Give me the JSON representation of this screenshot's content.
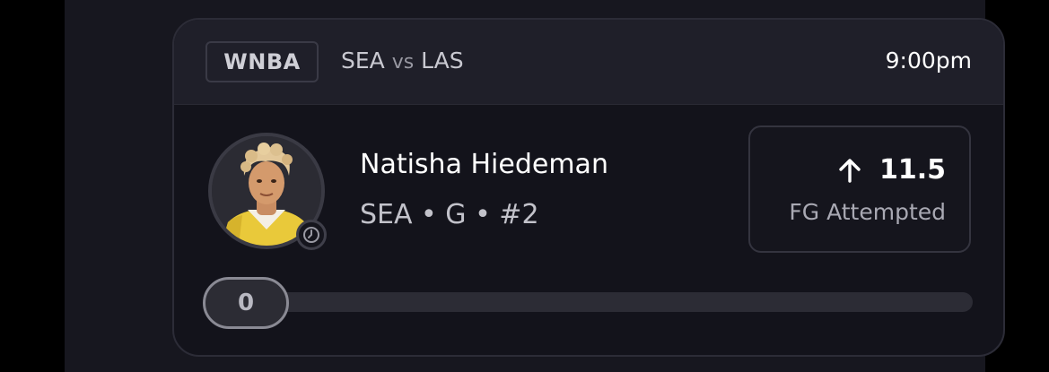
{
  "game": {
    "league": "WNBA",
    "home_team": "SEA",
    "vs": "vs",
    "away_team": "LAS",
    "time": "9:00pm"
  },
  "player": {
    "name": "Natisha Hiedeman",
    "meta": "SEA • G • #2",
    "avatar_icon": "player-headshot",
    "status_icon": "clock-icon"
  },
  "prop": {
    "direction_icon": "arrow-up-icon",
    "line": "11.5",
    "stat": "FG Attempted"
  },
  "progress": {
    "current": "0",
    "fraction": 0
  },
  "colors": {
    "background": "#13131b",
    "header": "#1f1f29",
    "text_primary": "#ffffff",
    "text_secondary": "#c2c2ca"
  }
}
